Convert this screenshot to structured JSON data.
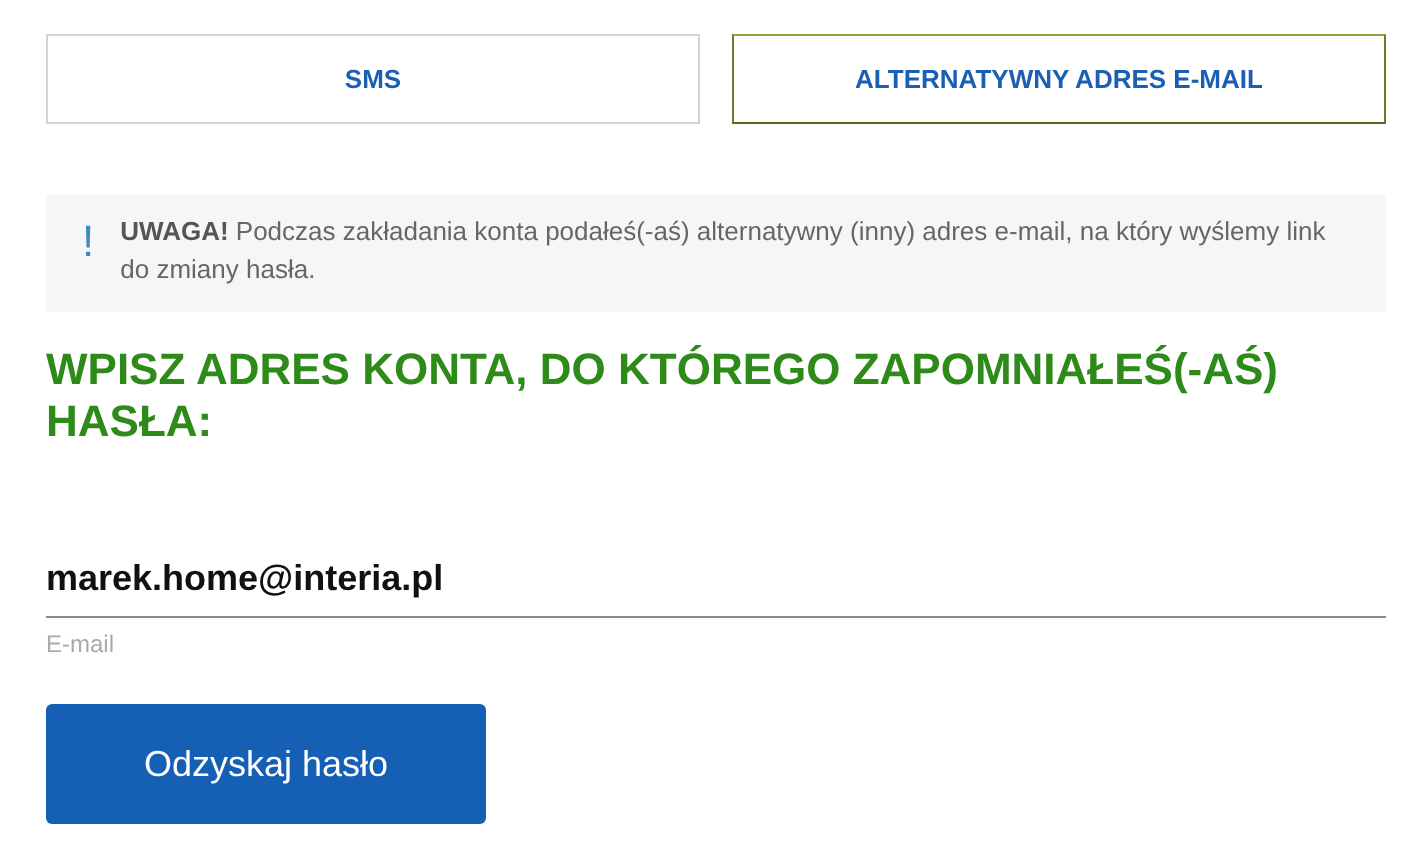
{
  "tabs": [
    {
      "label": "SMS",
      "selected": false
    },
    {
      "label": "ALTERNATYWNY ADRES E-MAIL",
      "selected": true
    }
  ],
  "notice": {
    "icon": "!",
    "text": "**UWAGA!** Podczas zakładania konta podałeś(-aś) alternatywny (inny) adres e-mail, na który wyślemy link do zmiany hasła."
  },
  "heading": "WPISZ ADRES KONTA, DO KTÓREGO ZAPOMNIAŁEŚ(-AŚ) HASŁA:",
  "email_field": {
    "value": "marek.home@interia.pl",
    "label": "E-mail"
  },
  "buttons": [
    "Odzyskaj hasło"
  ]
}
